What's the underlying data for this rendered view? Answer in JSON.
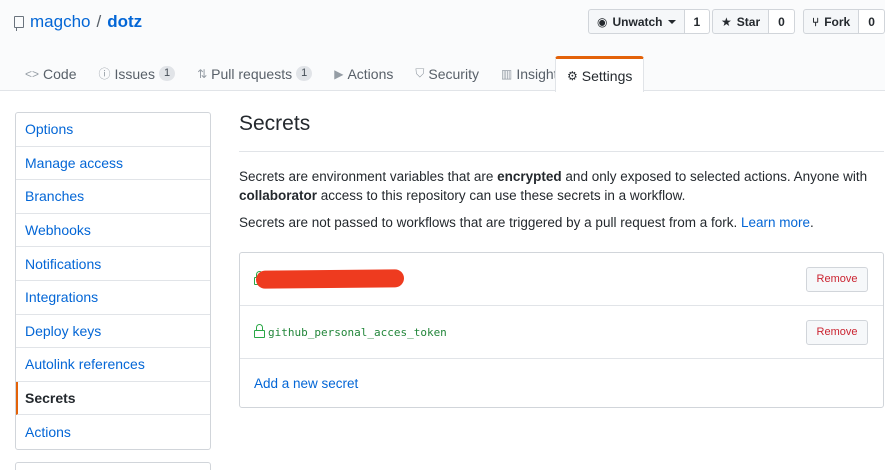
{
  "repo": {
    "owner": "magcho",
    "separator": "/",
    "name": "dotz"
  },
  "actions": {
    "watch": {
      "label": "Unwatch",
      "count": "1",
      "icon": "eye-icon"
    },
    "star": {
      "label": "Star",
      "count": "0",
      "icon": "star-icon"
    },
    "fork": {
      "label": "Fork",
      "count": "0",
      "icon": "repo-forked-icon"
    }
  },
  "tabs": [
    {
      "label": "Code",
      "icon": "code-icon"
    },
    {
      "label": "Issues",
      "count": "1",
      "icon": "issue-opened-icon"
    },
    {
      "label": "Pull requests",
      "count": "1",
      "icon": "git-pull-request-icon"
    },
    {
      "label": "Actions",
      "icon": "play-icon"
    },
    {
      "label": "Security",
      "icon": "shield-icon"
    },
    {
      "label": "Insights",
      "icon": "graph-icon"
    },
    {
      "label": "Settings",
      "icon": "gear-icon",
      "selected": true
    }
  ],
  "sidebar": {
    "items": [
      {
        "label": "Options"
      },
      {
        "label": "Manage access"
      },
      {
        "label": "Branches"
      },
      {
        "label": "Webhooks"
      },
      {
        "label": "Notifications"
      },
      {
        "label": "Integrations"
      },
      {
        "label": "Deploy keys"
      },
      {
        "label": "Autolink references"
      },
      {
        "label": "Secrets",
        "active": true
      },
      {
        "label": "Actions"
      }
    ]
  },
  "main": {
    "title": "Secrets",
    "desc1_a": "Secrets are environment variables that are ",
    "desc1_b": "encrypted",
    "desc1_c": " and only exposed to selected actions. Anyone with ",
    "desc1_d": "collaborator",
    "desc1_e": " access to this repository can use these secrets in a workflow.",
    "desc2": "Secrets are not passed to workflows that are triggered by a pull request from a fork. ",
    "learn_more": "Learn more",
    "desc2_end": ".",
    "secrets": [
      {
        "name": "",
        "redacted": true,
        "remove_label": "Remove"
      },
      {
        "name": "github_personal_acces_token",
        "redacted": false,
        "remove_label": "Remove"
      }
    ],
    "add_secret": "Add a new secret"
  },
  "colors": {
    "accent": "#e36209",
    "link": "#0366d6",
    "danger": "#cb2431",
    "secret_green": "#22863a",
    "redaction": "#ee3b1f"
  }
}
